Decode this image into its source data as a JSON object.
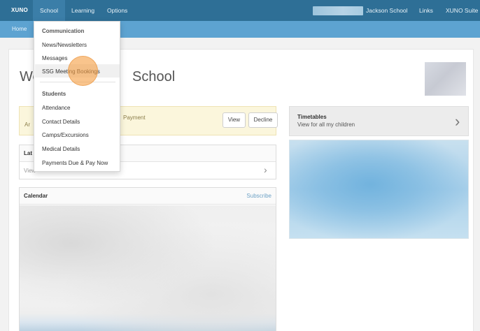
{
  "navbar": {
    "brand": "XUNO",
    "menu": [
      "School",
      "Learning",
      "Options"
    ],
    "school_name": "Jackson School",
    "links": "Links",
    "suite": "XUNO Suite"
  },
  "breadcrumb": {
    "home": "Home"
  },
  "page": {
    "welcome_start": "We",
    "welcome_end": "School"
  },
  "notice": {
    "line1_fragment": "",
    "line2_fragment": "Ar",
    "payment": "Payment",
    "view_label": "View",
    "decline_label": "Decline"
  },
  "latest": {
    "title": "Lat",
    "row_label": "View"
  },
  "calendar": {
    "title": "Calendar",
    "subscribe": "Subscribe"
  },
  "timetables": {
    "title": "Timetables",
    "subtitle": "View for all my children"
  },
  "dropdown": {
    "communication_header": "Communication",
    "communication_items": [
      "News/Newsletters",
      "Messages",
      "SSG Meeting Bookings"
    ],
    "students_header": "Students",
    "students_items": [
      "Attendance",
      "Contact Details",
      "Camps/Excursions",
      "Medical Details",
      "Payments Due & Pay Now"
    ]
  },
  "colors": {
    "navbar": "#2e6f96",
    "subbar": "#5da3d1",
    "notice_bg": "#fbf6dc",
    "cursor": "#f5a046"
  },
  "icons": {
    "chevron": "chevron-right-icon"
  }
}
